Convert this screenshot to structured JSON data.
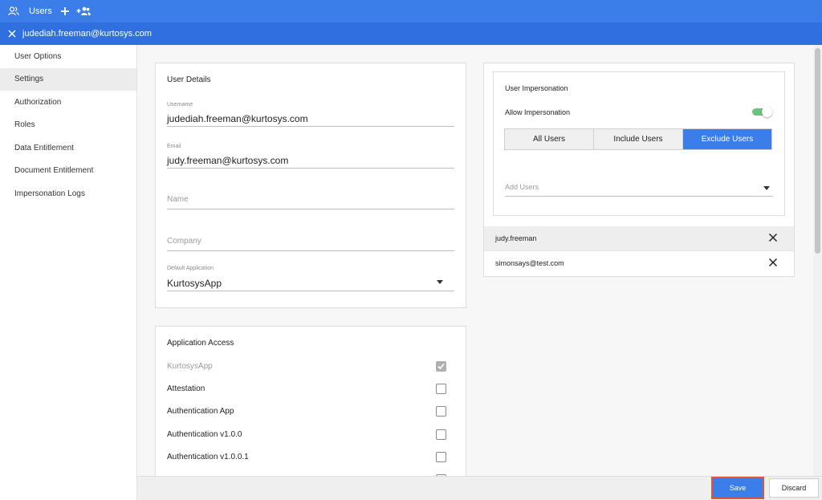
{
  "topbar": {
    "title": "Users"
  },
  "subbar": {
    "title": "judediah.freeman@kurtosys.com"
  },
  "sidebar": {
    "items": [
      {
        "label": "User Options"
      },
      {
        "label": "Settings",
        "active": true
      },
      {
        "label": "Authorization"
      },
      {
        "label": "Roles"
      },
      {
        "label": "Data Entitlement"
      },
      {
        "label": "Document Entitlement"
      },
      {
        "label": "Impersonation Logs"
      }
    ]
  },
  "user_details": {
    "title": "User Details",
    "username_label": "Username",
    "username_value": "judediah.freeman@kurtosys.com",
    "email_label": "Email",
    "email_value": "judy.freeman@kurtosys.com",
    "name_placeholder": "Name",
    "company_placeholder": "Company",
    "default_app_label": "Default Application",
    "default_app_value": "KurtosysApp"
  },
  "application_access": {
    "title": "Application Access",
    "apps": [
      {
        "label": "KurtosysApp",
        "checked": true,
        "disabled": true
      },
      {
        "label": "Attestation",
        "checked": false
      },
      {
        "label": "Authentication App",
        "checked": false
      },
      {
        "label": "Authentication v1.0.0",
        "checked": false
      },
      {
        "label": "Authentication v1.0.0.1",
        "checked": false
      }
    ]
  },
  "impersonation": {
    "title": "User Impersonation",
    "allow_label": "Allow Impersonation",
    "allow_enabled": true,
    "modes": [
      {
        "label": "All Users",
        "active": false
      },
      {
        "label": "Include Users",
        "active": false
      },
      {
        "label": "Exclude Users",
        "active": true
      }
    ],
    "add_users_placeholder": "Add Users",
    "users": [
      {
        "name": "judy.freeman"
      },
      {
        "name": "simonsays@test.com"
      }
    ]
  },
  "footer": {
    "save_label": "Save",
    "discard_label": "Discard"
  },
  "colors": {
    "primary": "#3b7de9",
    "toggle_on": "#6cc47c",
    "save_outline": "#e0572e"
  }
}
